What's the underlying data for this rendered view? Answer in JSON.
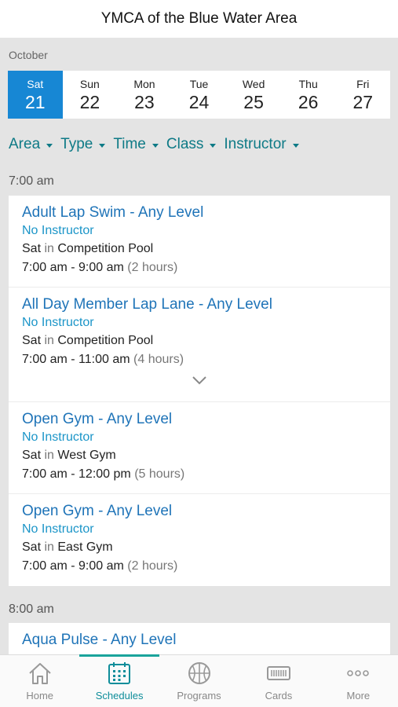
{
  "header": {
    "title": "YMCA of the Blue Water Area"
  },
  "calendar": {
    "month": "October",
    "days": [
      {
        "name": "Sat",
        "num": "21",
        "selected": true
      },
      {
        "name": "Sun",
        "num": "22"
      },
      {
        "name": "Mon",
        "num": "23"
      },
      {
        "name": "Tue",
        "num": "24"
      },
      {
        "name": "Wed",
        "num": "25"
      },
      {
        "name": "Thu",
        "num": "26"
      },
      {
        "name": "Fri",
        "num": "27"
      }
    ]
  },
  "filters": [
    "Area",
    "Type",
    "Time",
    "Class",
    "Instructor"
  ],
  "groups": [
    {
      "time": "7:00 am",
      "sessions": [
        {
          "title": "Adult Lap Swim - Any Level",
          "instructor": "No Instructor",
          "day": "Sat",
          "in": "in",
          "location": "Competition Pool",
          "range": "7:00 am - 9:00 am",
          "duration": "(2 hours)"
        },
        {
          "title": "All Day Member Lap Lane - Any Level",
          "instructor": "No Instructor",
          "day": "Sat",
          "in": "in",
          "location": "Competition Pool",
          "range": "7:00 am - 11:00 am",
          "duration": "(4 hours)"
        },
        {
          "title": "Open Gym - Any Level",
          "instructor": "No Instructor",
          "day": "Sat",
          "in": "in",
          "location": "West Gym",
          "range": "7:00 am - 12:00 pm",
          "duration": "(5 hours)"
        },
        {
          "title": "Open Gym - Any Level",
          "instructor": "No Instructor",
          "day": "Sat",
          "in": "in",
          "location": "East Gym",
          "range": "7:00 am - 9:00 am",
          "duration": "(2 hours)"
        }
      ]
    },
    {
      "time": "8:00 am",
      "sessions": [
        {
          "title": "Aqua Pulse - Any Level"
        }
      ]
    }
  ],
  "tabs": [
    {
      "label": "Home",
      "icon": "home-icon"
    },
    {
      "label": "Schedules",
      "icon": "calendar-icon",
      "active": true
    },
    {
      "label": "Programs",
      "icon": "basketball-icon"
    },
    {
      "label": "Cards",
      "icon": "card-icon"
    },
    {
      "label": "More",
      "icon": "more-icon"
    }
  ]
}
